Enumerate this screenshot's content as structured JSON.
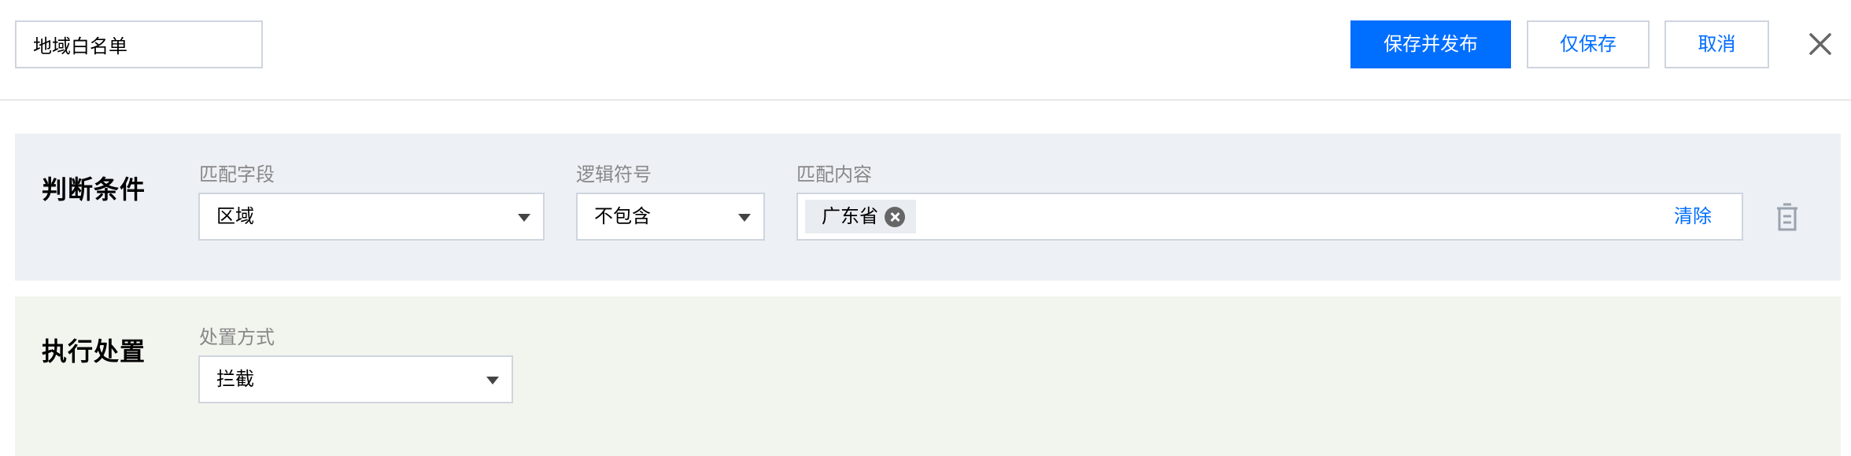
{
  "header": {
    "name_value": "地域白名单",
    "save_publish_label": "保存并发布",
    "save_only_label": "仅保存",
    "cancel_label": "取消",
    "close_icon": "close-icon"
  },
  "condition": {
    "title": "判断条件",
    "match_field_label": "匹配字段",
    "match_field_value": "区域",
    "logic_label": "逻辑符号",
    "logic_value": "不包含",
    "content_label": "匹配内容",
    "tags": [
      "广东省"
    ],
    "clear_label": "清除",
    "delete_icon": "trash-icon"
  },
  "execution": {
    "title": "执行处置",
    "method_label": "处置方式",
    "method_value": "拦截"
  },
  "colors": {
    "primary": "#006eff",
    "condition_bg": "#edf0f5",
    "execution_bg": "#f2f4ee",
    "label_gray": "#888888"
  }
}
